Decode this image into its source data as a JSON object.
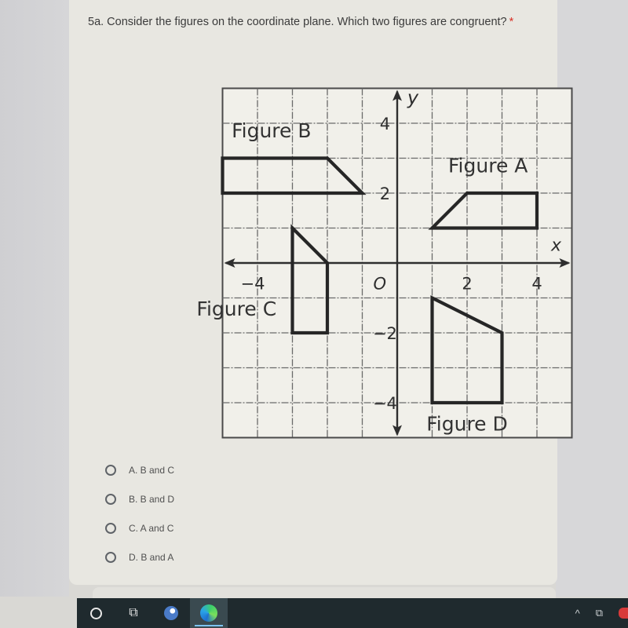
{
  "form": {
    "question": "5a. Consider the figures on the coordinate plane. Which two figures are congruent?",
    "required_marker": "*",
    "options": [
      {
        "label": "A. B and C",
        "selected": false
      },
      {
        "label": "B. B and D",
        "selected": false
      },
      {
        "label": "C. A and C",
        "selected": false
      },
      {
        "label": "D. B and A",
        "selected": false
      }
    ]
  },
  "chart_data": {
    "type": "diagram",
    "title": "",
    "xlabel": "x",
    "ylabel": "y",
    "xlim": [
      -5,
      5
    ],
    "ylim": [
      -5,
      5
    ],
    "grid": true,
    "grid_step": 1,
    "origin_label": "O",
    "x_tick_labels": [
      {
        "value": -4,
        "label": "−4"
      },
      {
        "value": 2,
        "label": "2"
      },
      {
        "value": 4,
        "label": "4"
      }
    ],
    "y_tick_labels": [
      {
        "value": 4,
        "label": "4"
      },
      {
        "value": 2,
        "label": "2"
      },
      {
        "value": -2,
        "label": "−2"
      },
      {
        "value": -4,
        "label": "−4"
      }
    ],
    "figures": [
      {
        "name": "Figure A",
        "points": [
          [
            1,
            1
          ],
          [
            2,
            2
          ],
          [
            4,
            2
          ],
          [
            4,
            1
          ]
        ],
        "label_at": [
          2.6,
          2.6
        ]
      },
      {
        "name": "Figure B",
        "points": [
          [
            -5,
            3
          ],
          [
            -2,
            3
          ],
          [
            -1,
            2
          ],
          [
            -5,
            2
          ]
        ],
        "label_at": [
          -3.6,
          3.6
        ]
      },
      {
        "name": "Figure C",
        "points": [
          [
            -3,
            1
          ],
          [
            -3,
            -2
          ],
          [
            -2,
            -2
          ],
          [
            -2,
            0
          ]
        ],
        "label_at": [
          -4.6,
          -1.5
        ]
      },
      {
        "name": "Figure D",
        "points": [
          [
            1,
            -1
          ],
          [
            3,
            -2
          ],
          [
            3,
            -4
          ],
          [
            1,
            -4
          ]
        ],
        "label_at": [
          2.0,
          -4.8
        ]
      }
    ]
  },
  "taskbar": {
    "items": [
      {
        "name": "search",
        "icon": "search-circle-icon"
      },
      {
        "name": "task-view",
        "icon": "task-view-icon",
        "glyph": "⧉"
      },
      {
        "name": "steam",
        "icon": "steam-icon"
      },
      {
        "name": "edge",
        "icon": "edge-icon",
        "active": true
      }
    ],
    "tray": {
      "chevron": "^",
      "device": "⧉"
    }
  }
}
